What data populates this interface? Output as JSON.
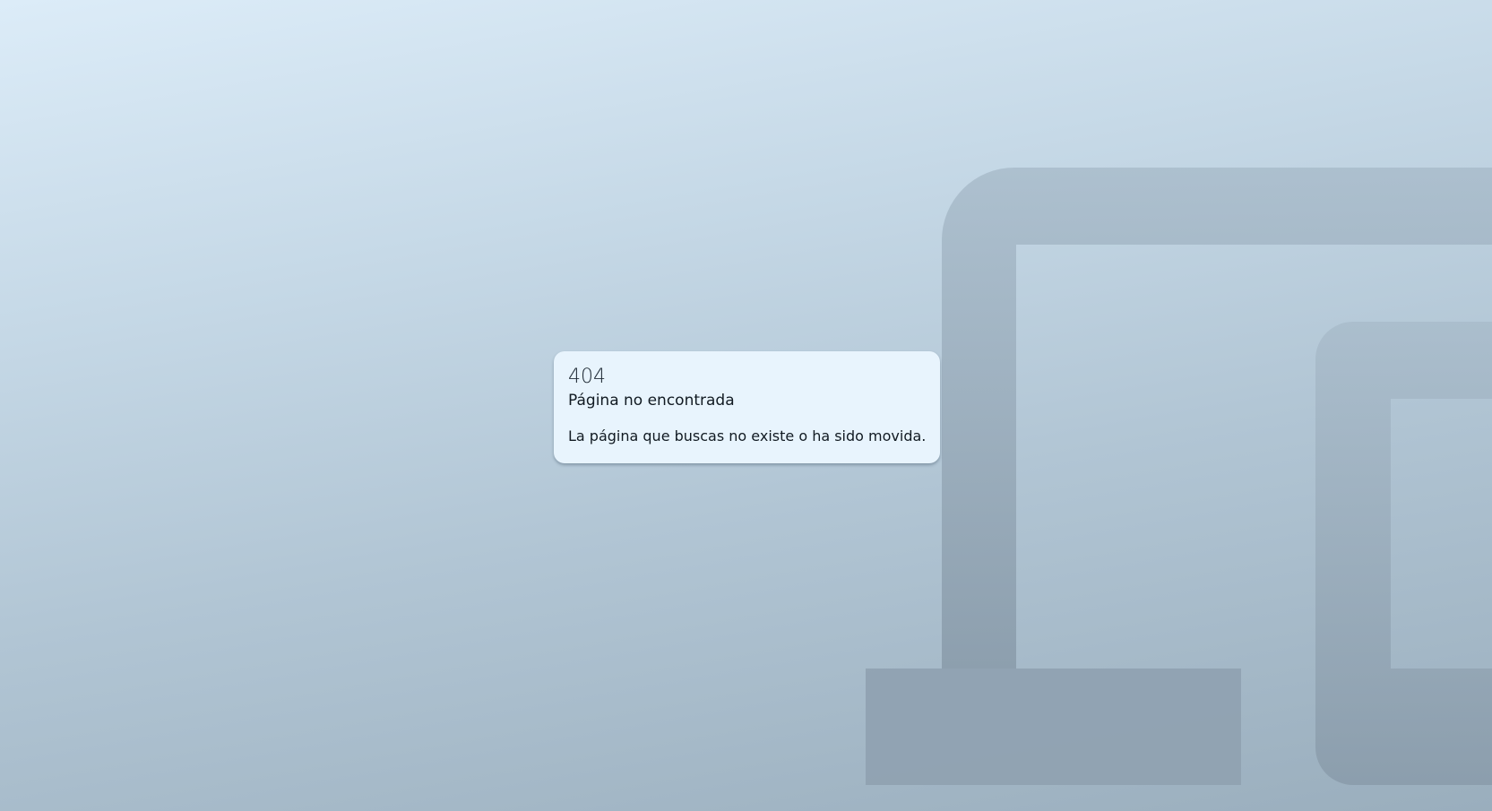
{
  "error": {
    "code": "404",
    "title": "Página no encontrada",
    "message": "La página que buscas no existe o ha sido movida."
  },
  "background": {
    "icon": "devices-icon",
    "gradient_top": "#dcecf8",
    "gradient_bottom": "#9aaebd",
    "icon_color": "#8a9cab"
  },
  "card": {
    "background": "#e8f4fd"
  }
}
